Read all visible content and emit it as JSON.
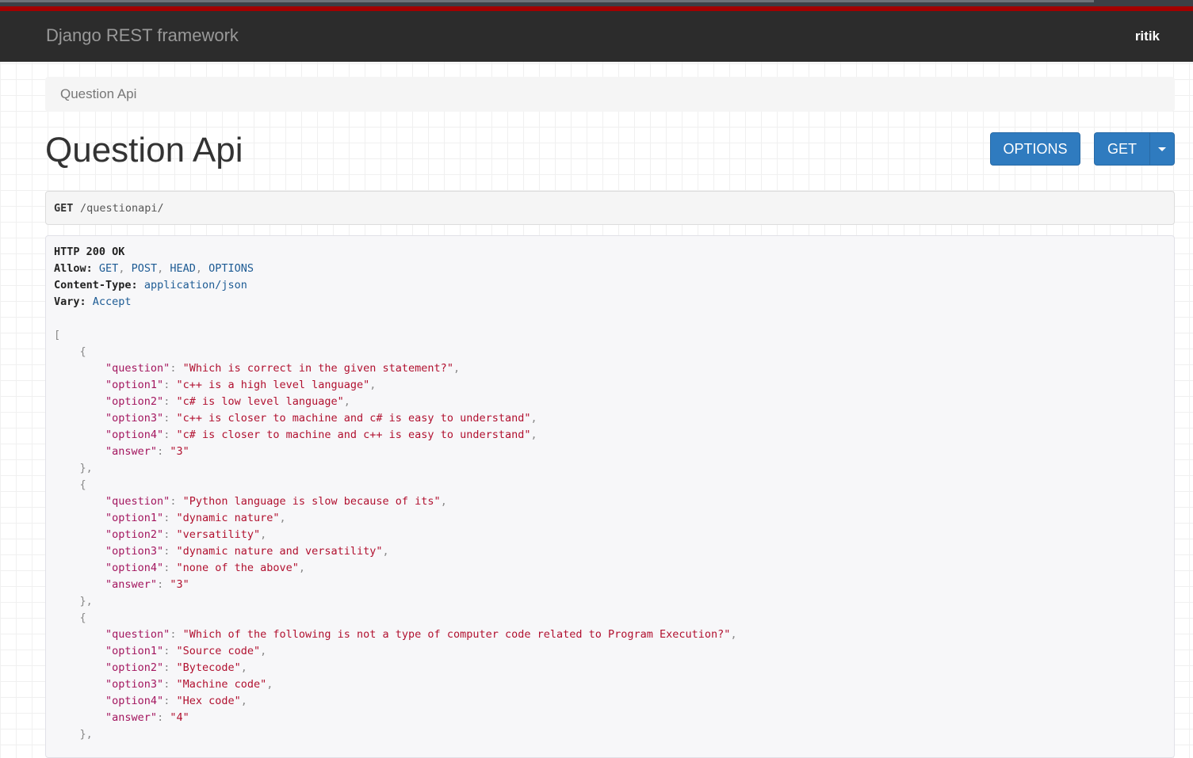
{
  "navbar": {
    "brand": "Django REST framework",
    "user": "ritik"
  },
  "breadcrumb": {
    "item": "Question Api"
  },
  "page": {
    "title": "Question Api"
  },
  "buttons": {
    "options": "OPTIONS",
    "get": "GET"
  },
  "request": {
    "method": "GET",
    "path": "/questionapi/"
  },
  "response": {
    "status": "HTTP 200 OK",
    "headers": [
      {
        "name": "Allow:",
        "values": [
          "GET",
          "POST",
          "HEAD",
          "OPTIONS"
        ]
      },
      {
        "name": "Content-Type:",
        "values": [
          "application/json"
        ]
      },
      {
        "name": "Vary:",
        "values": [
          "Accept"
        ]
      }
    ],
    "body": [
      {
        "question": "Which is correct in the given statement?",
        "option1": "c++ is a high level language",
        "option2": "c# is low level language",
        "option3": "c++ is closer to machine and c# is easy to understand",
        "option4": "c# is closer to machine and c++ is easy to understand",
        "answer": "3"
      },
      {
        "question": "Python language is slow because of its",
        "option1": "dynamic nature",
        "option2": "versatility",
        "option3": "dynamic nature and versatility",
        "option4": "none of the above",
        "answer": "3"
      },
      {
        "question": "Which of the following is not a type of computer code related to Program Execution?",
        "option1": "Source code",
        "option2": "Bytecode",
        "option3": "Machine code",
        "option4": "Hex code",
        "answer": "4"
      }
    ]
  },
  "colors": {
    "navbar": "#2c2c2c",
    "accent_red": "#a30000",
    "button": "#2f7bbf",
    "string": "#b1102f",
    "key": "#a3155e",
    "literal": "#1d5b94"
  }
}
